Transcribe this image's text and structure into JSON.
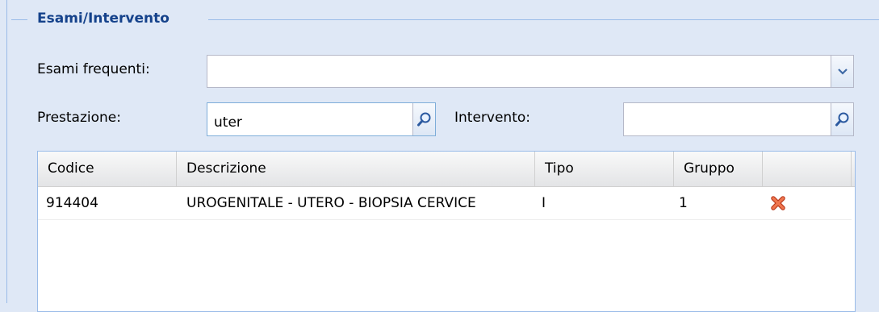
{
  "fieldset": {
    "legend": "Esami/Intervento"
  },
  "esami_frequenti": {
    "label": "Esami frequenti:",
    "value": ""
  },
  "prestazione": {
    "label": "Prestazione:",
    "value": "uter"
  },
  "intervento": {
    "label": "Intervento:",
    "value": ""
  },
  "grid": {
    "columns": [
      "Codice",
      "Descrizione",
      "Tipo",
      "Gruppo",
      ""
    ],
    "rows": [
      {
        "codice": "914404",
        "descrizione": "UROGENITALE - UTERO - BIOPSIA CERVICE",
        "tipo": "I",
        "gruppo": "1",
        "action_icon": "delete-icon"
      }
    ]
  },
  "colors": {
    "accent": "#15428b",
    "border": "#99bbe8",
    "delete": "#e8603c"
  }
}
